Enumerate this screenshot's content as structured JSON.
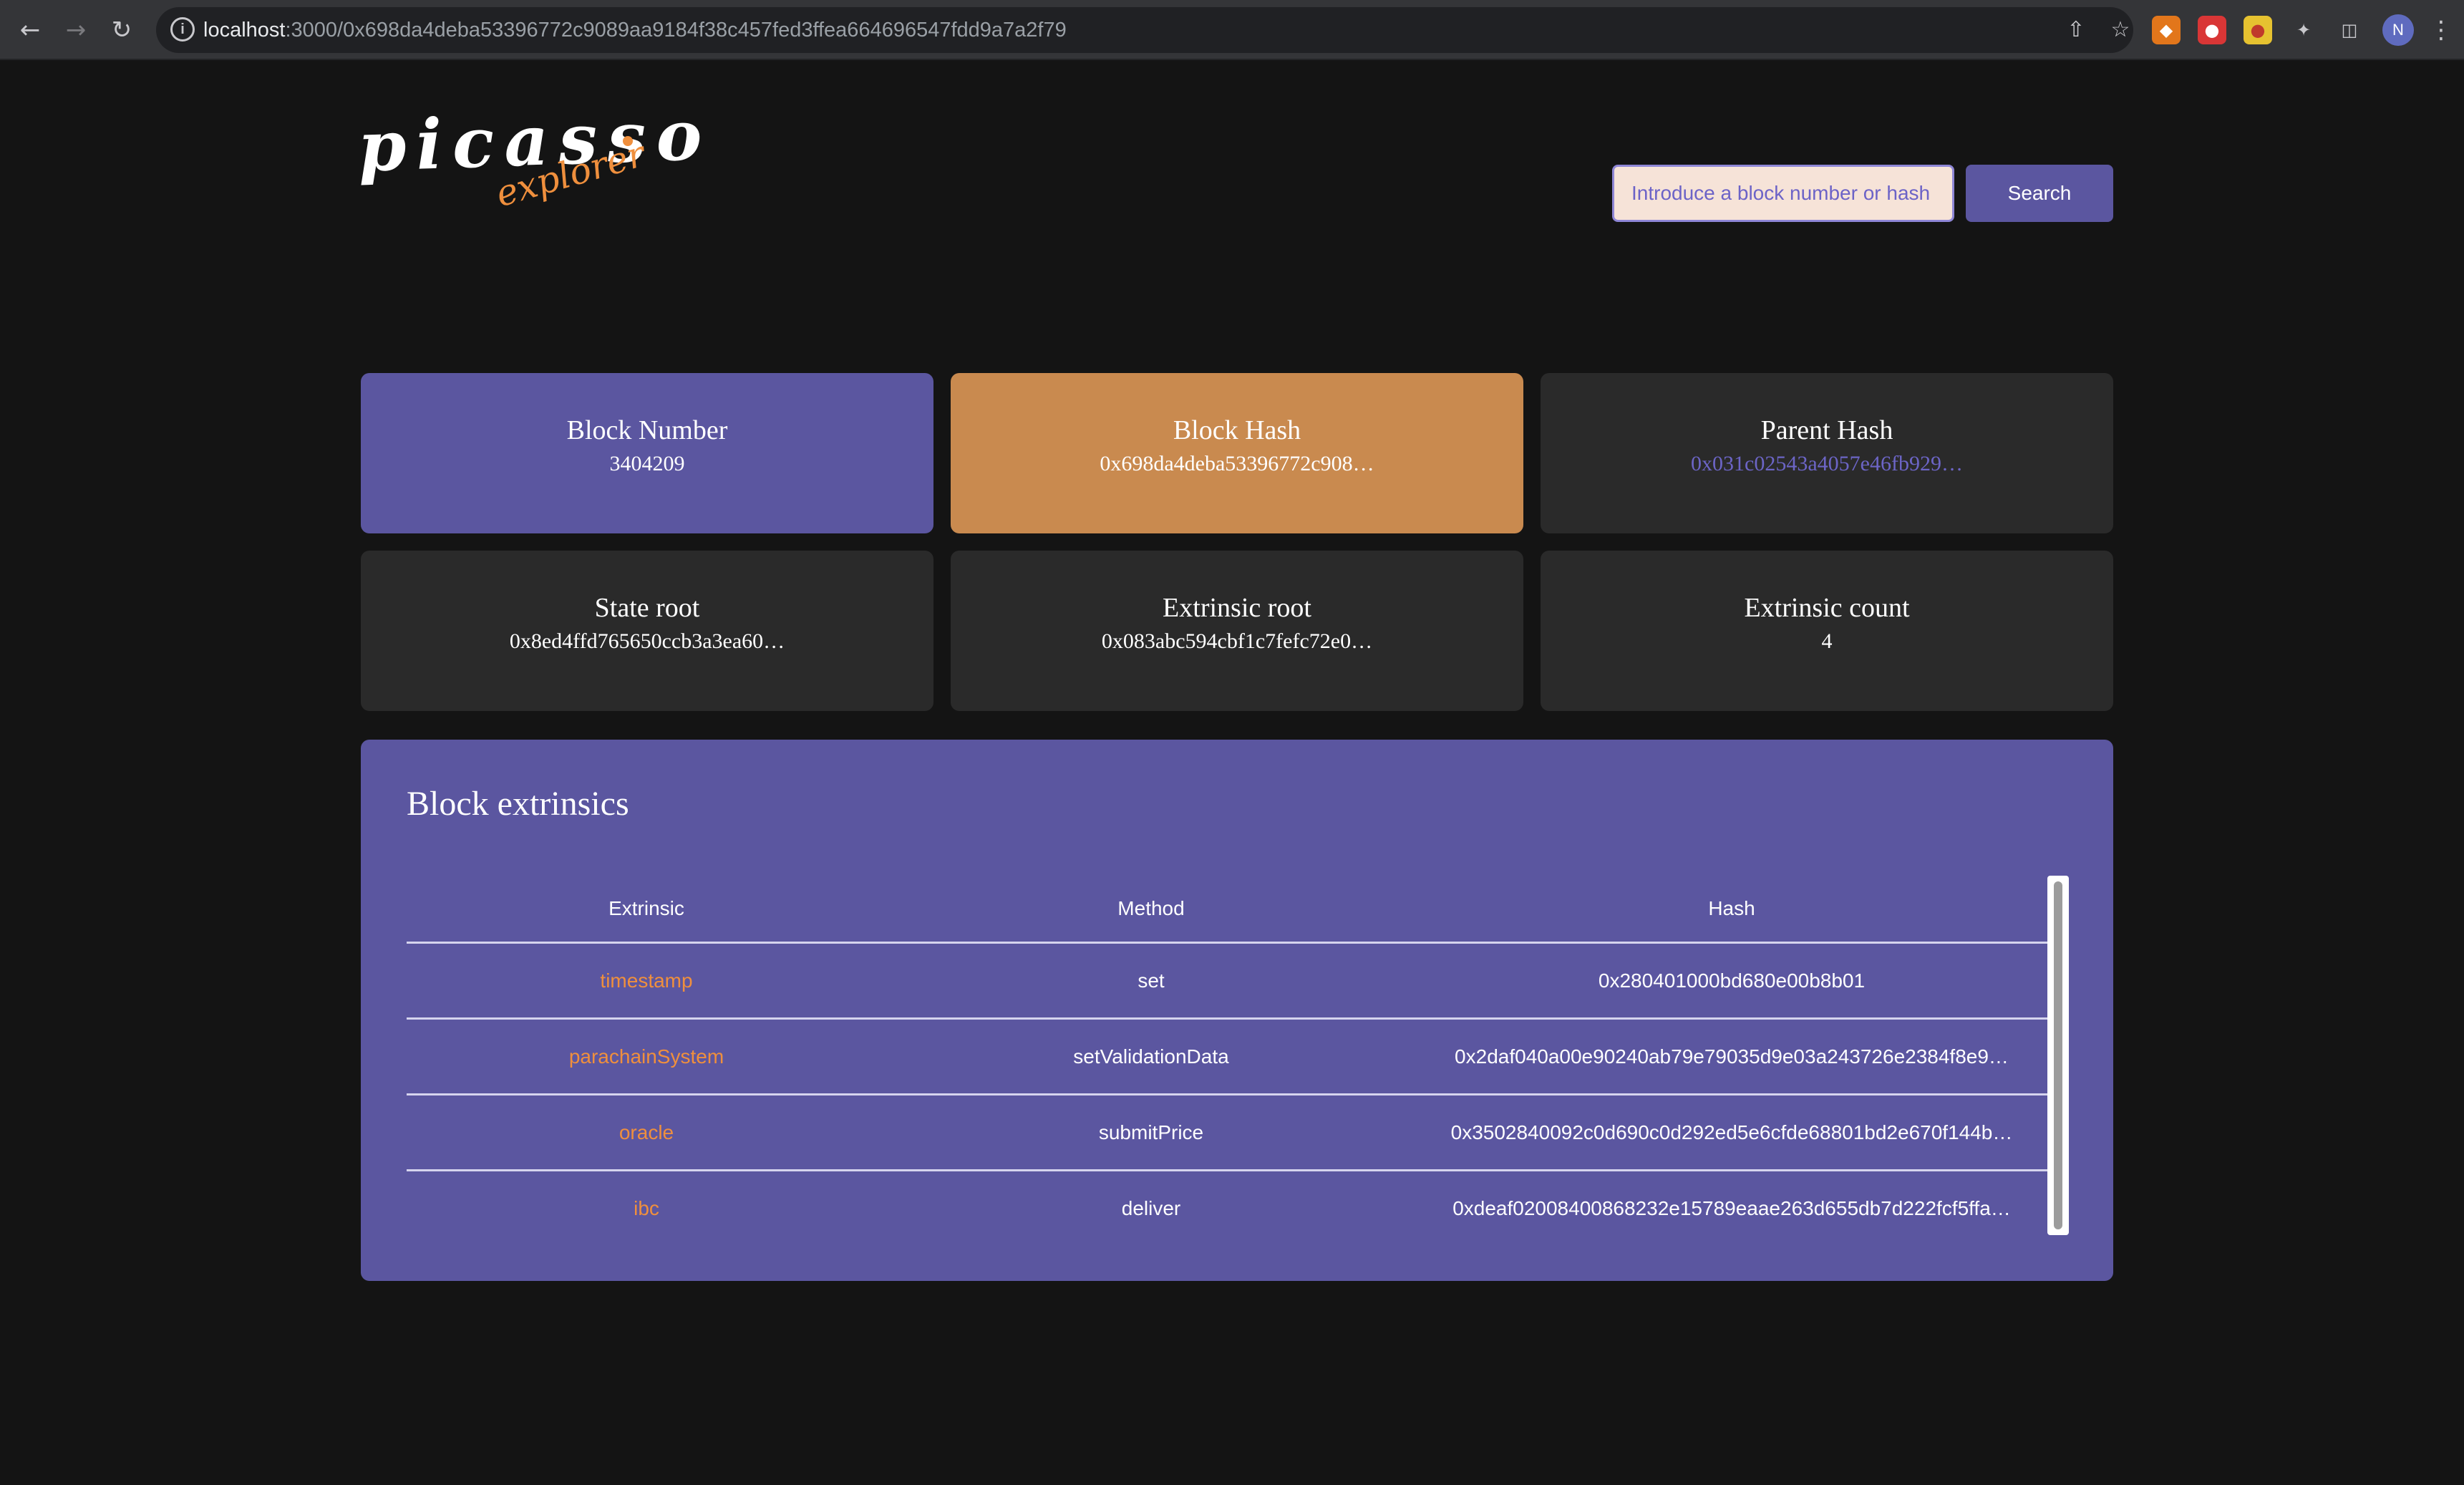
{
  "browser": {
    "url_host": "localhost",
    "url_path": ":3000/0x698da4deba53396772c9089aa9184f38c457fed3ffea664696547fdd9a7a2f79",
    "profile_initial": "N",
    "icons": [
      "back-icon",
      "forward-icon",
      "reload-icon",
      "info-icon",
      "share-icon",
      "star-icon",
      "metamask-icon",
      "extension-icon",
      "extension-icon",
      "puzzle-icon",
      "sidebar-icon",
      "menu-icon"
    ]
  },
  "header": {
    "logo_main": "picasso",
    "logo_sub": "explorer",
    "search_placeholder": "Introduce a block number or hash",
    "search_button": "Search"
  },
  "cards": [
    {
      "title": "Block Number",
      "value": "3404209"
    },
    {
      "title": "Block Hash",
      "value": "0x698da4deba53396772c908…"
    },
    {
      "title": "Parent Hash",
      "value": "0x031c02543a4057e46fb929…"
    },
    {
      "title": "State root",
      "value": "0x8ed4ffd765650ccb3a3ea60…"
    },
    {
      "title": "Extrinsic root",
      "value": "0x083abc594cbf1c7fefc72e0…"
    },
    {
      "title": "Extrinsic count",
      "value": "4"
    }
  ],
  "extrinsics": {
    "title": "Block extrinsics",
    "columns": [
      "Extrinsic",
      "Method",
      "Hash"
    ],
    "rows": [
      {
        "extrinsic": "timestamp",
        "method": "set",
        "hash": "0x280401000bd680e00b8b01"
      },
      {
        "extrinsic": "parachainSystem",
        "method": "setValidationData",
        "hash": "0x2daf040a00e90240ab79e79035d9e03a243726e2384f8e9…"
      },
      {
        "extrinsic": "oracle",
        "method": "submitPrice",
        "hash": "0x3502840092c0d690c0d292ed5e6cfde68801bd2e670f144b…"
      },
      {
        "extrinsic": "ibc",
        "method": "deliver",
        "hash": "0xdeaf02008400868232e15789eaae263d655db7d222fcf5ffa…"
      }
    ]
  },
  "colors": {
    "accent_purple": "#5b56a0",
    "accent_orange": "#c98a4f",
    "link_orange": "#ef8f3d",
    "background": "#141414",
    "card_dark": "#2a2a2a"
  }
}
